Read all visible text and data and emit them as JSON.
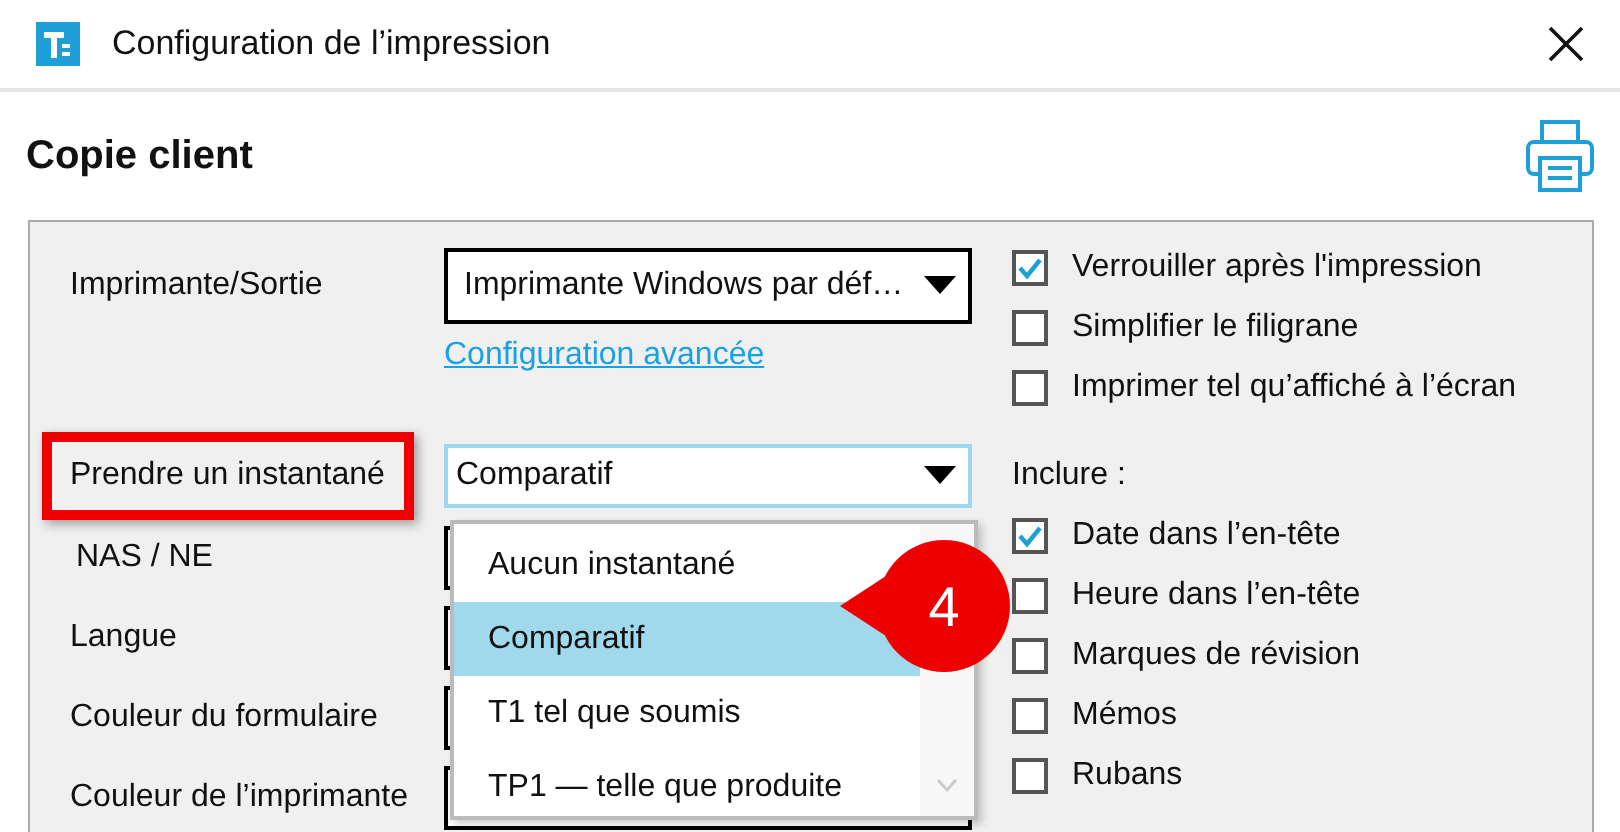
{
  "window": {
    "title": "Configuration de l’impression"
  },
  "header": {
    "title": "Copie client"
  },
  "printer": {
    "label": "Imprimante/Sortie",
    "value": "Imprimante Windows par déf…",
    "link": "Configuration avancée"
  },
  "snapshot": {
    "label": "Prendre un instantané",
    "highlighted": true,
    "value": "Comparatif",
    "options": [
      {
        "label": "Aucun instantané",
        "selected": false
      },
      {
        "label": "Comparatif",
        "selected": true
      },
      {
        "label": "T1 tel que soumis",
        "selected": false
      },
      {
        "label": "TP1 — telle que produite",
        "selected": false
      }
    ]
  },
  "other_fields": [
    {
      "label": "NAS / NE"
    },
    {
      "label": "Langue"
    },
    {
      "label": "Couleur du formulaire"
    },
    {
      "label": "Couleur de l’imprimante"
    }
  ],
  "options": [
    {
      "label": "Verrouiller après l'impression",
      "checked": true
    },
    {
      "label": "Simplifier le filigrane",
      "checked": false
    },
    {
      "label": "Imprimer tel qu’affiché à l’écran",
      "checked": false
    }
  ],
  "include": {
    "label": "Inclure :",
    "items": [
      {
        "label": "Date dans l’en-tête",
        "checked": true
      },
      {
        "label": "Heure dans l’en-tête",
        "checked": false
      },
      {
        "label": "Marques de révision",
        "checked": false
      },
      {
        "label": "Mémos",
        "checked": false
      },
      {
        "label": "Rubans",
        "checked": false
      }
    ]
  },
  "callout": {
    "number": "4"
  }
}
